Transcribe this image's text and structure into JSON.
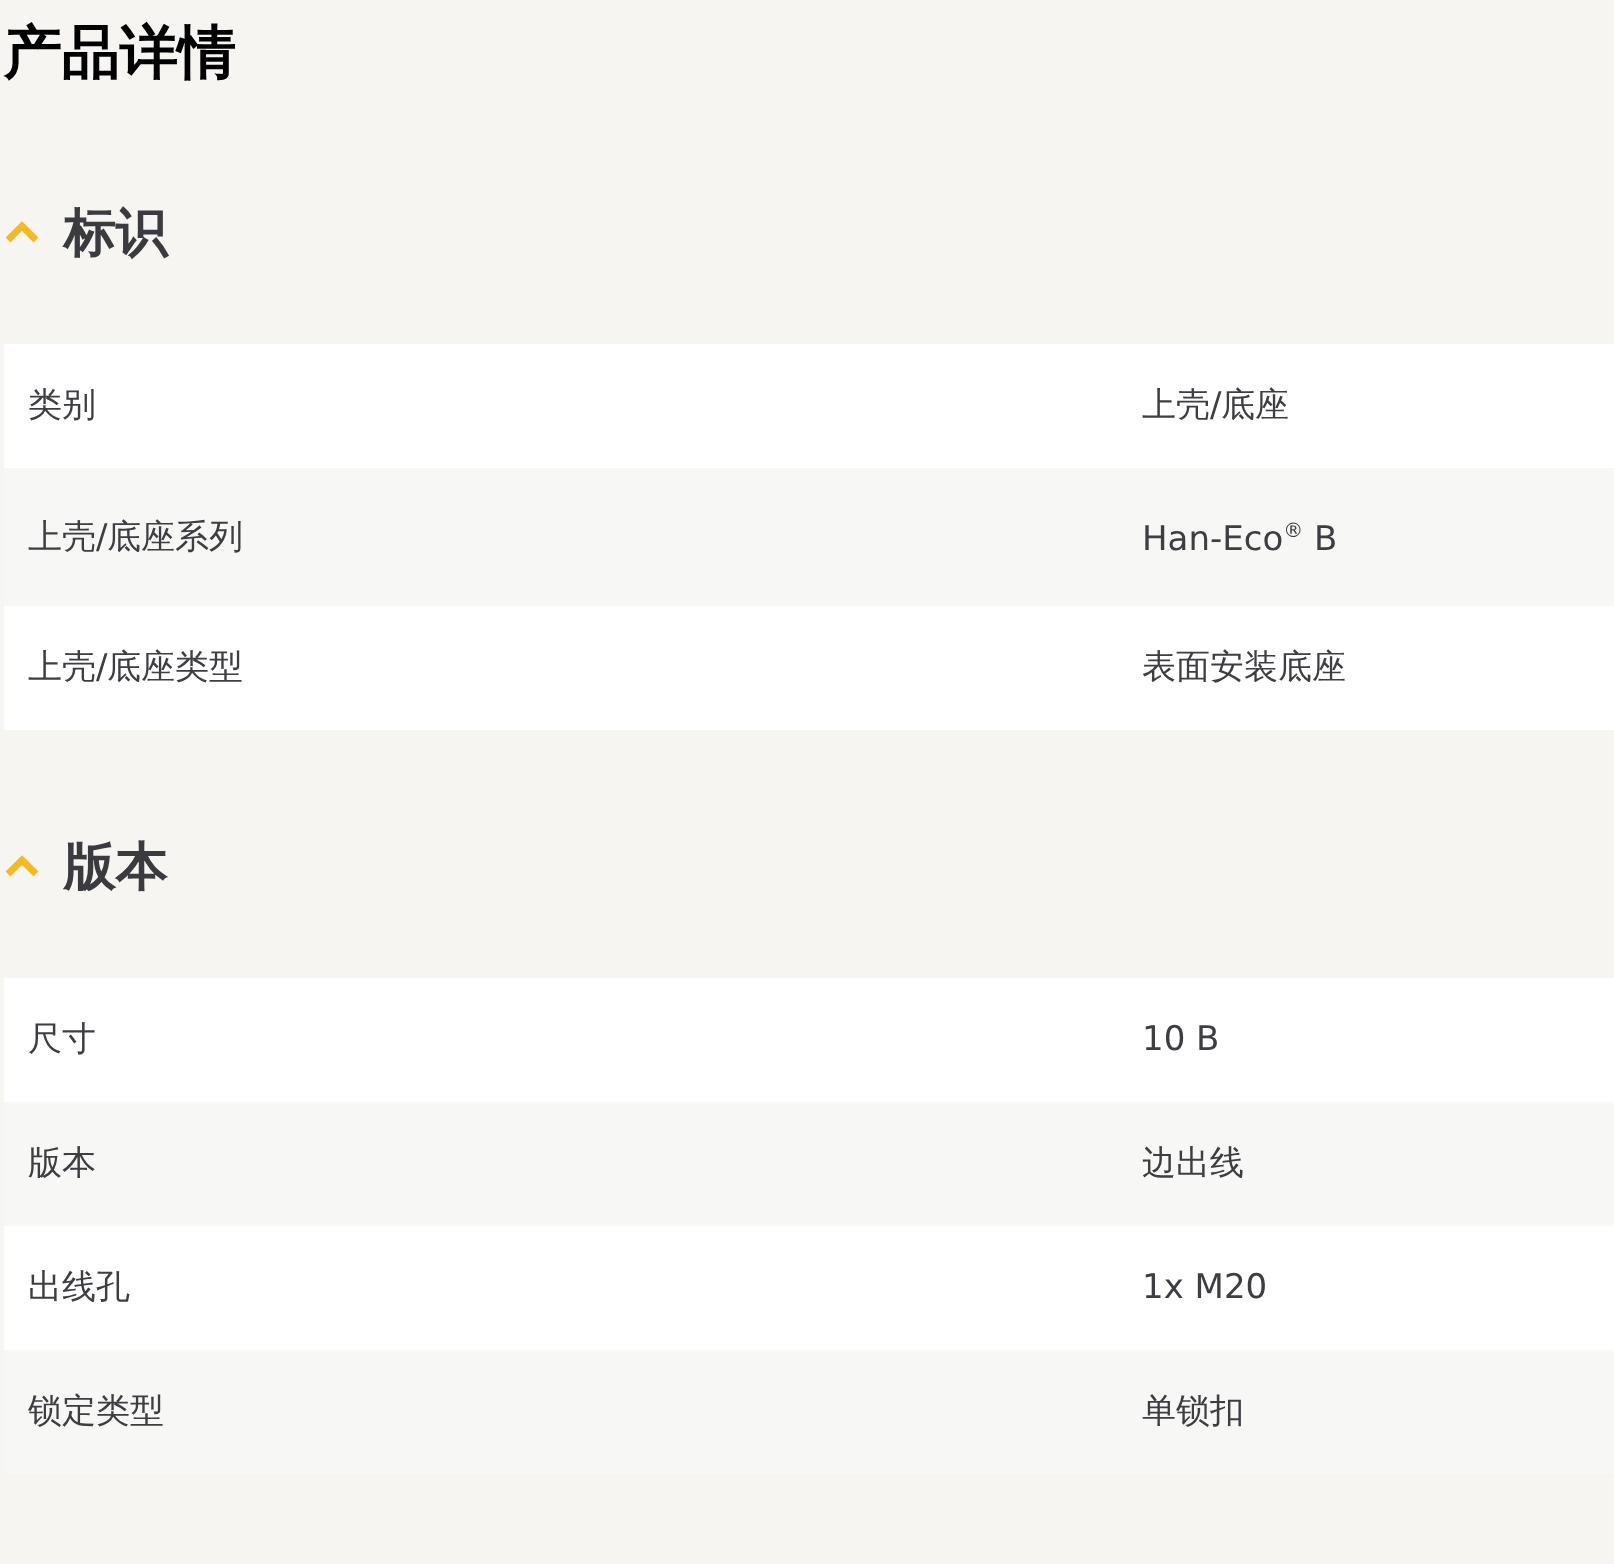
{
  "title": "产品详情",
  "sections": [
    {
      "title": "标识",
      "expanded": true,
      "rows": [
        {
          "label": "类别",
          "value": "上壳/底座"
        },
        {
          "label": "上壳/底座系列",
          "value": "Han-Eco$^{®}$ B"
        },
        {
          "label": "上壳/底座类型",
          "value": "表面安装底座"
        }
      ]
    },
    {
      "title": "版本",
      "expanded": true,
      "rows": [
        {
          "label": "尺寸",
          "value": "10 B"
        },
        {
          "label": "版本",
          "value": "边出线"
        },
        {
          "label": "出线孔",
          "value": "1x M20"
        },
        {
          "label": "锁定类型",
          "value": "单锁扣"
        }
      ]
    }
  ]
}
